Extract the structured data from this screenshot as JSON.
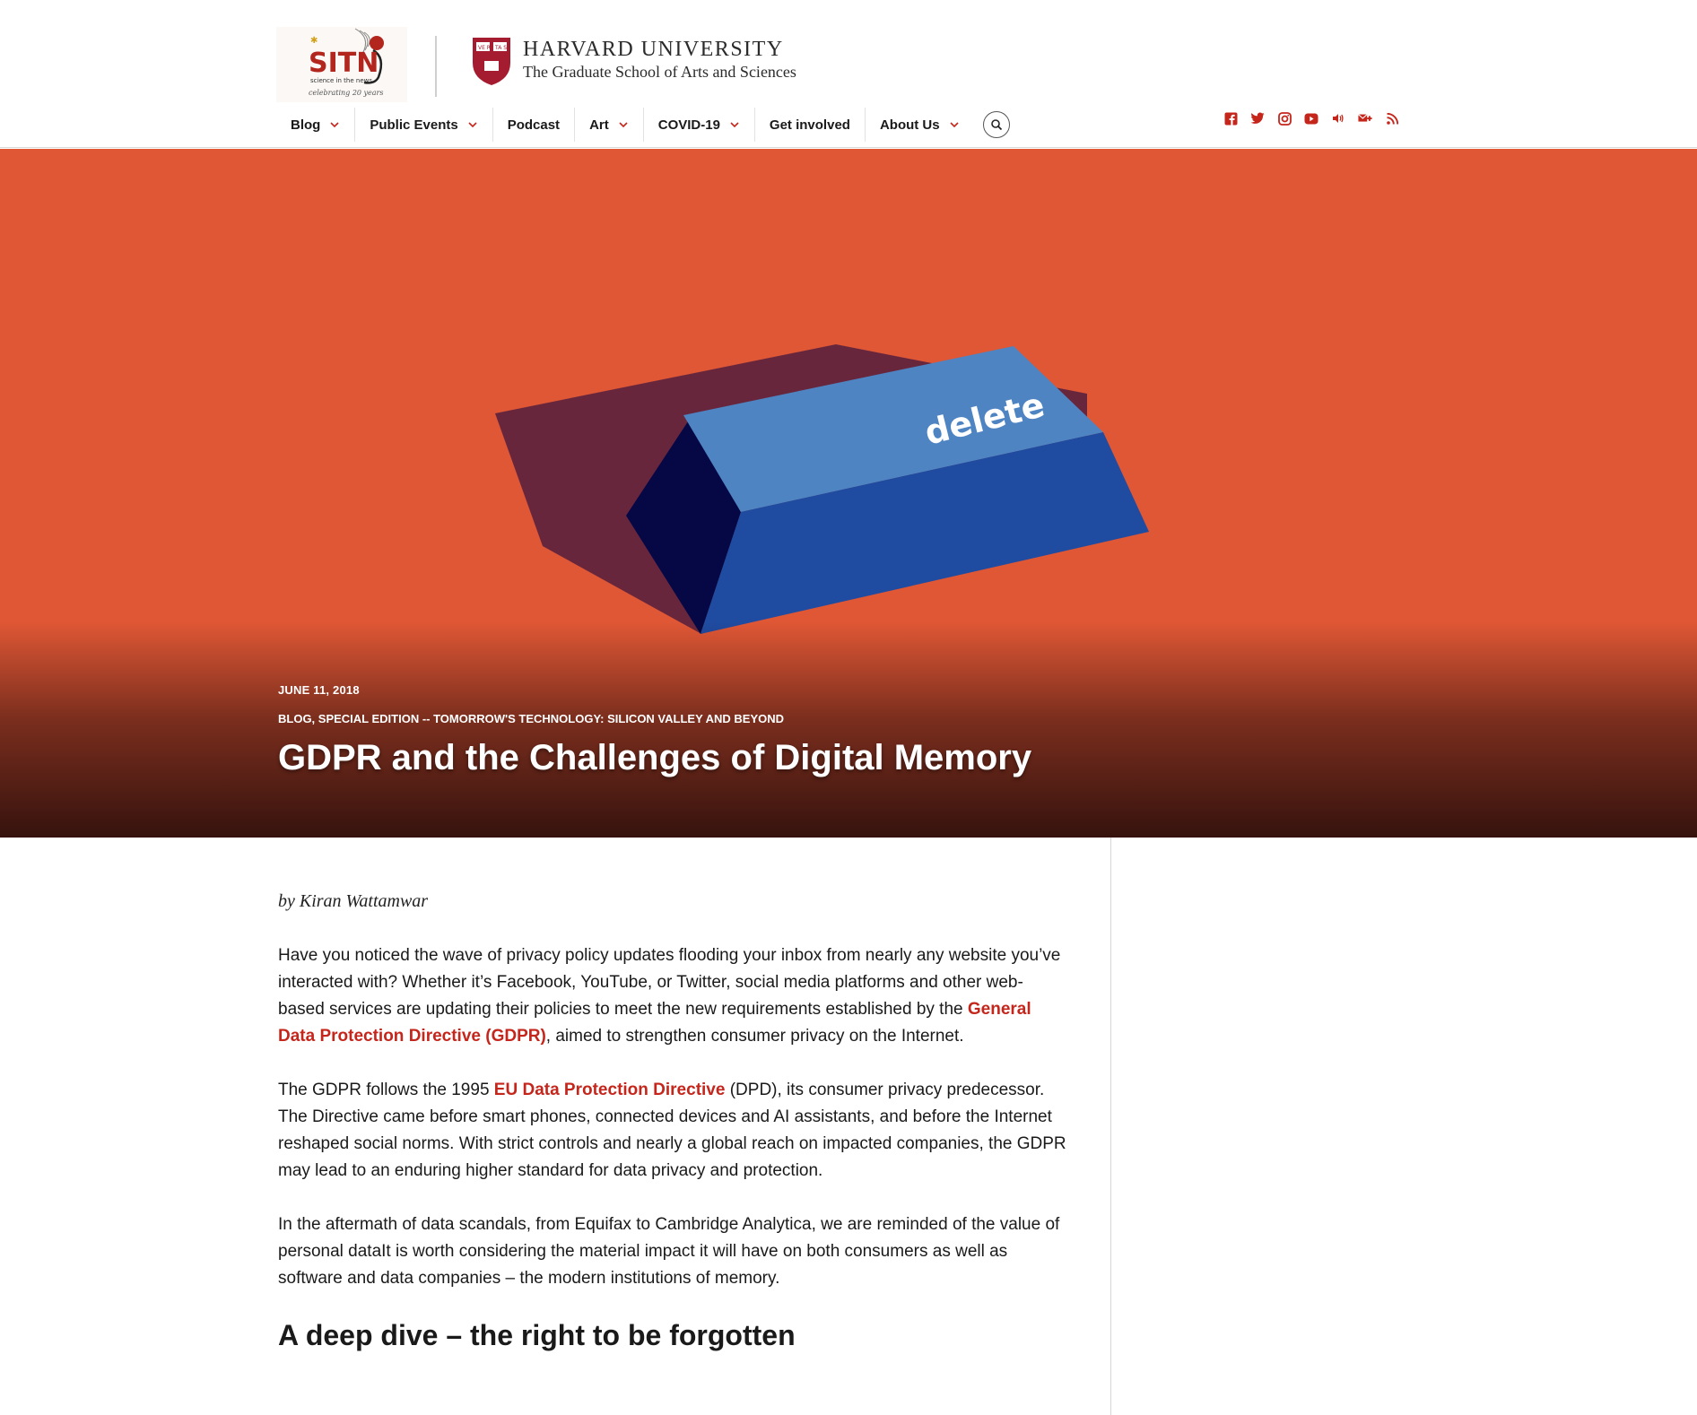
{
  "header": {
    "sitn_logo": {
      "main": "SITN",
      "sub": "science in the news",
      "tagline": "celebrating 20 years"
    },
    "harvard": {
      "title": "HARVARD UNIVERSITY",
      "subtitle": "The Graduate School of Arts and Sciences"
    },
    "nav": [
      {
        "label": "Blog",
        "has_dropdown": true
      },
      {
        "label": "Public Events",
        "has_dropdown": true
      },
      {
        "label": "Podcast",
        "has_dropdown": false
      },
      {
        "label": "Art",
        "has_dropdown": true
      },
      {
        "label": "COVID-19",
        "has_dropdown": true
      },
      {
        "label": "Get involved",
        "has_dropdown": false
      },
      {
        "label": "About Us",
        "has_dropdown": true
      }
    ],
    "social_icons": [
      "facebook-icon",
      "twitter-icon",
      "instagram-icon",
      "youtube-icon",
      "podcast-icon",
      "email-icon",
      "rss-icon"
    ],
    "accent_color": "#c5261c"
  },
  "hero": {
    "background_color": "#df5735",
    "key_label": "delete",
    "date": "JUNE 11, 2018",
    "categories": "BLOG, SPECIAL EDITION -- TOMORROW'S TECHNOLOGY: SILICON VALLEY AND BEYOND",
    "title": "GDPR and the Challenges of Digital Memory"
  },
  "article": {
    "byline": "by Kiran Wattamwar",
    "p1": {
      "before": "Have you noticed the wave of privacy policy updates flooding your inbox from nearly any website you’ve interacted with? Whether it’s Facebook, YouTube, or Twitter, social media platforms and other web-based services are updating their policies to meet the new requirements established by the ",
      "link": "General Data Protection Directive (GDPR)",
      "after": ", aimed to strengthen consumer privacy on the Internet."
    },
    "p2": {
      "before": "The GDPR follows the 1995 ",
      "link": "EU Data Protection Directive",
      "after": " (DPD), its consumer privacy predecessor. The Directive came before smart phones, connected devices and AI assistants, and before the Internet reshaped social norms. With strict controls and nearly a global reach on impacted companies, the GDPR may lead to an enduring higher standard for data privacy and protection."
    },
    "p3": "In the aftermath of data scandals, from Equifax to Cambridge Analytica, we are reminded of the value of personal dataIt is worth considering the material impact it will have on both consumers as well as software and data companies – the modern institutions of memory.",
    "heading": "A deep dive – the right to be forgotten"
  }
}
